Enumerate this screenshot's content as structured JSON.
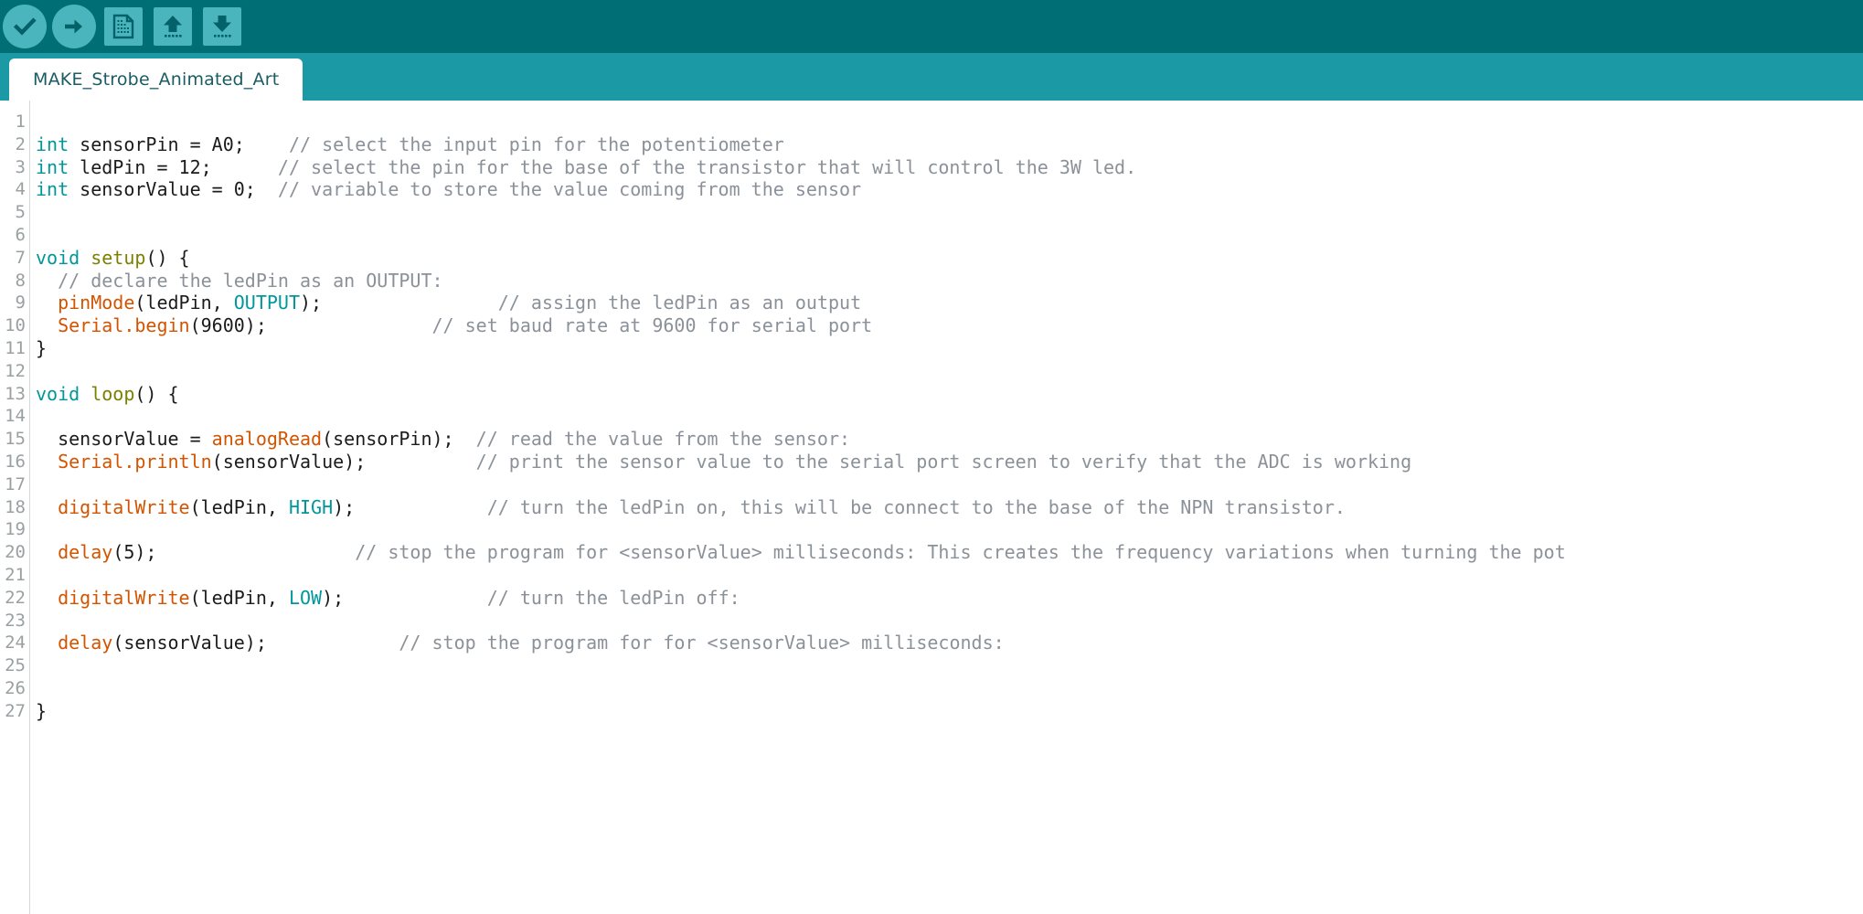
{
  "window": {
    "title": "MAKE_Strobe_Animated_Art",
    "toolbar_bg": "#006e75",
    "tabbar_bg": "#1b9aa5",
    "icon_bg": "#4bb5bd",
    "icon_fg": "#006e75"
  },
  "toolbar": {
    "buttons": [
      {
        "name": "verify-button",
        "icon": "check-icon",
        "label": "Verify",
        "shape": "round"
      },
      {
        "name": "upload-button",
        "icon": "arrow-right-icon",
        "label": "Upload",
        "shape": "round"
      },
      {
        "name": "new-button",
        "icon": "new-document-icon",
        "label": "New",
        "shape": "square"
      },
      {
        "name": "open-button",
        "icon": "arrow-up-icon",
        "label": "Open",
        "shape": "square"
      },
      {
        "name": "save-button",
        "icon": "arrow-down-icon",
        "label": "Save",
        "shape": "square"
      }
    ]
  },
  "tabs": [
    {
      "label": "MAKE_Strobe_Animated_Art",
      "active": true
    }
  ],
  "editor": {
    "line_numbers": [
      1,
      2,
      3,
      4,
      5,
      6,
      7,
      8,
      9,
      10,
      11,
      12,
      13,
      14,
      15,
      16,
      17,
      18,
      19,
      20,
      21,
      22,
      23,
      24,
      25,
      26,
      27
    ],
    "lines": [
      [],
      [
        {
          "t": "kw",
          "s": "int"
        },
        {
          "t": "txt",
          "s": " sensorPin = A0;    "
        },
        {
          "t": "cmt",
          "s": "// select the input pin for the potentiometer"
        }
      ],
      [
        {
          "t": "kw",
          "s": "int"
        },
        {
          "t": "txt",
          "s": " ledPin = 12;      "
        },
        {
          "t": "cmt",
          "s": "// select the pin for the base of the transistor that will control the 3W led."
        }
      ],
      [
        {
          "t": "kw",
          "s": "int"
        },
        {
          "t": "txt",
          "s": " sensorValue = 0;  "
        },
        {
          "t": "cmt",
          "s": "// variable to store the value coming from the sensor"
        }
      ],
      [],
      [],
      [
        {
          "t": "kw",
          "s": "void"
        },
        {
          "t": "txt",
          "s": " "
        },
        {
          "t": "fn",
          "s": "setup"
        },
        {
          "t": "txt",
          "s": "() {"
        }
      ],
      [
        {
          "t": "txt",
          "s": "  "
        },
        {
          "t": "cmt",
          "s": "// declare the ledPin as an OUTPUT:"
        }
      ],
      [
        {
          "t": "txt",
          "s": "  "
        },
        {
          "t": "call",
          "s": "pinMode"
        },
        {
          "t": "txt",
          "s": "(ledPin, "
        },
        {
          "t": "cnst",
          "s": "OUTPUT"
        },
        {
          "t": "txt",
          "s": ");                "
        },
        {
          "t": "cmt",
          "s": "// assign the ledPin as an output"
        }
      ],
      [
        {
          "t": "txt",
          "s": "  "
        },
        {
          "t": "call",
          "s": "Serial.begin"
        },
        {
          "t": "txt",
          "s": "(9600);               "
        },
        {
          "t": "cmt",
          "s": "// set baud rate at 9600 for serial port"
        }
      ],
      [
        {
          "t": "txt",
          "s": "}"
        }
      ],
      [],
      [
        {
          "t": "kw",
          "s": "void"
        },
        {
          "t": "txt",
          "s": " "
        },
        {
          "t": "fn",
          "s": "loop"
        },
        {
          "t": "txt",
          "s": "() {"
        }
      ],
      [],
      [
        {
          "t": "txt",
          "s": "  sensorValue = "
        },
        {
          "t": "call",
          "s": "analogRead"
        },
        {
          "t": "txt",
          "s": "(sensorPin);  "
        },
        {
          "t": "cmt",
          "s": "// read the value from the sensor:"
        }
      ],
      [
        {
          "t": "txt",
          "s": "  "
        },
        {
          "t": "call",
          "s": "Serial.println"
        },
        {
          "t": "txt",
          "s": "(sensorValue);          "
        },
        {
          "t": "cmt",
          "s": "// print the sensor value to the serial port screen to verify that the ADC is working"
        }
      ],
      [],
      [
        {
          "t": "txt",
          "s": "  "
        },
        {
          "t": "call",
          "s": "digitalWrite"
        },
        {
          "t": "txt",
          "s": "(ledPin, "
        },
        {
          "t": "cnst",
          "s": "HIGH"
        },
        {
          "t": "txt",
          "s": ");            "
        },
        {
          "t": "cmt",
          "s": "// turn the ledPin on, this will be connect to the base of the NPN transistor."
        }
      ],
      [],
      [
        {
          "t": "txt",
          "s": "  "
        },
        {
          "t": "call",
          "s": "delay"
        },
        {
          "t": "txt",
          "s": "(5);                  "
        },
        {
          "t": "cmt",
          "s": "// stop the program for <sensorValue> milliseconds: This creates the frequency variations when turning the pot"
        }
      ],
      [],
      [
        {
          "t": "txt",
          "s": "  "
        },
        {
          "t": "call",
          "s": "digitalWrite"
        },
        {
          "t": "txt",
          "s": "(ledPin, "
        },
        {
          "t": "cnst",
          "s": "LOW"
        },
        {
          "t": "txt",
          "s": ");             "
        },
        {
          "t": "cmt",
          "s": "// turn the ledPin off:"
        }
      ],
      [],
      [
        {
          "t": "txt",
          "s": "  "
        },
        {
          "t": "call",
          "s": "delay"
        },
        {
          "t": "txt",
          "s": "(sensorValue);            "
        },
        {
          "t": "cmt",
          "s": "// stop the program for for <sensorValue> milliseconds:"
        }
      ],
      [],
      [],
      [
        {
          "t": "txt",
          "s": "}"
        }
      ]
    ]
  }
}
